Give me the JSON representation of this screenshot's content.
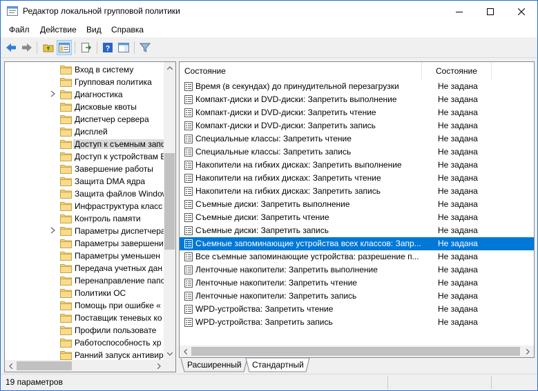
{
  "window": {
    "title": "Редактор локальной групповой политики"
  },
  "menu": [
    "Файл",
    "Действие",
    "Вид",
    "Справка"
  ],
  "toolbar": {
    "icons": [
      "back-arrow-icon",
      "forward-arrow-icon",
      "up-folder-icon",
      "show-hide-tree-icon",
      "export-list-icon",
      "help-icon",
      "show-pane-icon",
      "filter-icon"
    ]
  },
  "tree": {
    "items": [
      {
        "label": "Вход в систему",
        "expandable": false
      },
      {
        "label": "Групповая политика",
        "expandable": false
      },
      {
        "label": "Диагностика",
        "expandable": true
      },
      {
        "label": "Дисковые квоты",
        "expandable": false
      },
      {
        "label": "Диспетчер сервера",
        "expandable": false
      },
      {
        "label": "Дисплей",
        "expandable": false
      },
      {
        "label": "Доступ к съемным запо",
        "expandable": false,
        "selected": true
      },
      {
        "label": "Доступ к устройствам E",
        "expandable": false
      },
      {
        "label": "Завершение работы",
        "expandable": false
      },
      {
        "label": "Защита DMA ядра",
        "expandable": false
      },
      {
        "label": "Защита файлов Window",
        "expandable": false
      },
      {
        "label": "Инфраструктура класс",
        "expandable": false
      },
      {
        "label": "Контроль памяти",
        "expandable": false
      },
      {
        "label": "Параметры диспетчера",
        "expandable": true
      },
      {
        "label": "Параметры завершени",
        "expandable": false
      },
      {
        "label": "Параметры уменьшен",
        "expandable": false
      },
      {
        "label": "Передача учетных дан",
        "expandable": false
      },
      {
        "label": "Перенаправление папс",
        "expandable": false
      },
      {
        "label": "Политики ОС",
        "expandable": false
      },
      {
        "label": "Помощь при ошибке «",
        "expandable": false
      },
      {
        "label": "Поставщик теневых ко",
        "expandable": false
      },
      {
        "label": "Профили пользовате",
        "expandable": false
      },
      {
        "label": "Работоспособность хр",
        "expandable": false
      },
      {
        "label": "Ранний запуск антивир",
        "expandable": false
      }
    ]
  },
  "list": {
    "columns": [
      "Состояние",
      "Состояние"
    ],
    "rows": [
      {
        "name": "Время (в секундах) до принудительной перезагрузки",
        "state": "Не задана"
      },
      {
        "name": "Компакт-диски и DVD-диски: Запретить выполнение",
        "state": "Не задана"
      },
      {
        "name": "Компакт-диски и DVD-диски: Запретить чтение",
        "state": "Не задана"
      },
      {
        "name": "Компакт-диски и DVD-диски: Запретить запись",
        "state": "Не задана"
      },
      {
        "name": "Специальные классы: Запретить чтение",
        "state": "Не задана"
      },
      {
        "name": "Специальные классы: Запретить запись",
        "state": "Не задана"
      },
      {
        "name": "Накопители на гибких дисках: Запретить выполнение",
        "state": "Не задана"
      },
      {
        "name": "Накопители на гибких дисках: Запретить чтение",
        "state": "Не задана"
      },
      {
        "name": "Накопители на гибких дисках: Запретить запись",
        "state": "Не задана"
      },
      {
        "name": "Съемные диски: Запретить выполнение",
        "state": "Не задана"
      },
      {
        "name": "Съемные диски: Запретить чтение",
        "state": "Не задана"
      },
      {
        "name": "Съемные диски: Запретить запись",
        "state": "Не задана"
      },
      {
        "name": "Съемные запоминающие устройства всех классов: Запр...",
        "state": "Не задана",
        "selected": true
      },
      {
        "name": "Все съемные запоминающие устройства: разрешение п...",
        "state": "Не задана"
      },
      {
        "name": "Ленточные накопители: Запретить выполнение",
        "state": "Не задана"
      },
      {
        "name": "Ленточные накопители: Запретить чтение",
        "state": "Не задана"
      },
      {
        "name": "Ленточные накопители: Запретить запись",
        "state": "Не задана"
      },
      {
        "name": "WPD-устройства: Запретить чтение",
        "state": "Не задана"
      },
      {
        "name": "WPD-устройства: Запретить запись",
        "state": "Не задана"
      }
    ]
  },
  "tabs": [
    {
      "label": "Расширенный",
      "active": false
    },
    {
      "label": "Стандартный",
      "active": true
    }
  ],
  "status": {
    "text": "19 параметров"
  },
  "colors": {
    "selection": "#0078d7",
    "tree_selection": "#d9d9d9",
    "window_border": "#1e6fd9"
  }
}
